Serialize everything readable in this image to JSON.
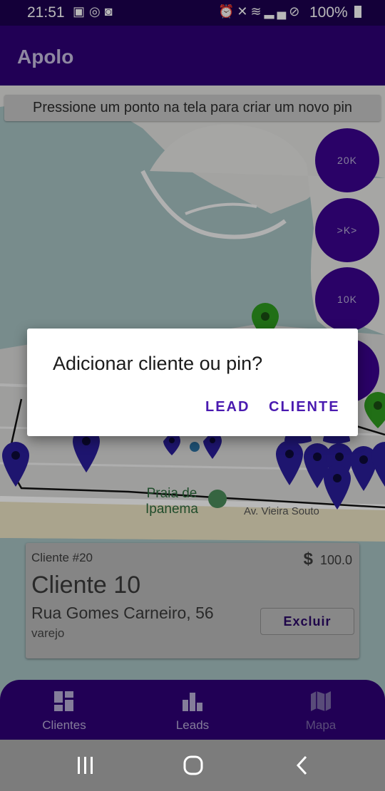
{
  "status_bar": {
    "time": "21:51",
    "battery": "100%",
    "left_icons": [
      "image-icon",
      "whatsapp-icon",
      "cast-icon"
    ],
    "right_icons": [
      "alarm-icon",
      "mute-icon",
      "wifi-icon",
      "signal-icon",
      "block-icon",
      "battery-icon"
    ]
  },
  "app_bar": {
    "title": "Apolo"
  },
  "map": {
    "hint": "Pressione um ponto na tela para criar um novo pin",
    "clusters": [
      "20K",
      ">K>",
      "10K"
    ],
    "labels": {
      "beach": "Praia de\nIpanema",
      "beach_line1": "Praia de",
      "beach_line2": "Ipanema",
      "street": "Av. Vieira Souto"
    }
  },
  "client_card": {
    "client_id": "Cliente #20",
    "currency": "$",
    "amount": "100.0",
    "name": "Cliente 10",
    "address": "Rua Gomes Carneiro, 56",
    "segment": "varejo",
    "delete_label": "Excluir"
  },
  "dialog": {
    "title": "Adicionar cliente ou pin?",
    "lead_label": "LEAD",
    "client_label": "CLIENTE"
  },
  "bottom_nav": {
    "items": [
      {
        "label": "Clientes",
        "icon": "dashboard-icon",
        "active": true
      },
      {
        "label": "Leads",
        "icon": "bar-chart-icon",
        "active": true
      },
      {
        "label": "Mapa",
        "icon": "map-icon",
        "active": false
      }
    ]
  },
  "colors": {
    "primary": "#2f0076",
    "accent": "#4a1ab0",
    "pin_green": "#2e9a1f",
    "pin_blue": "#2a1e9a"
  }
}
